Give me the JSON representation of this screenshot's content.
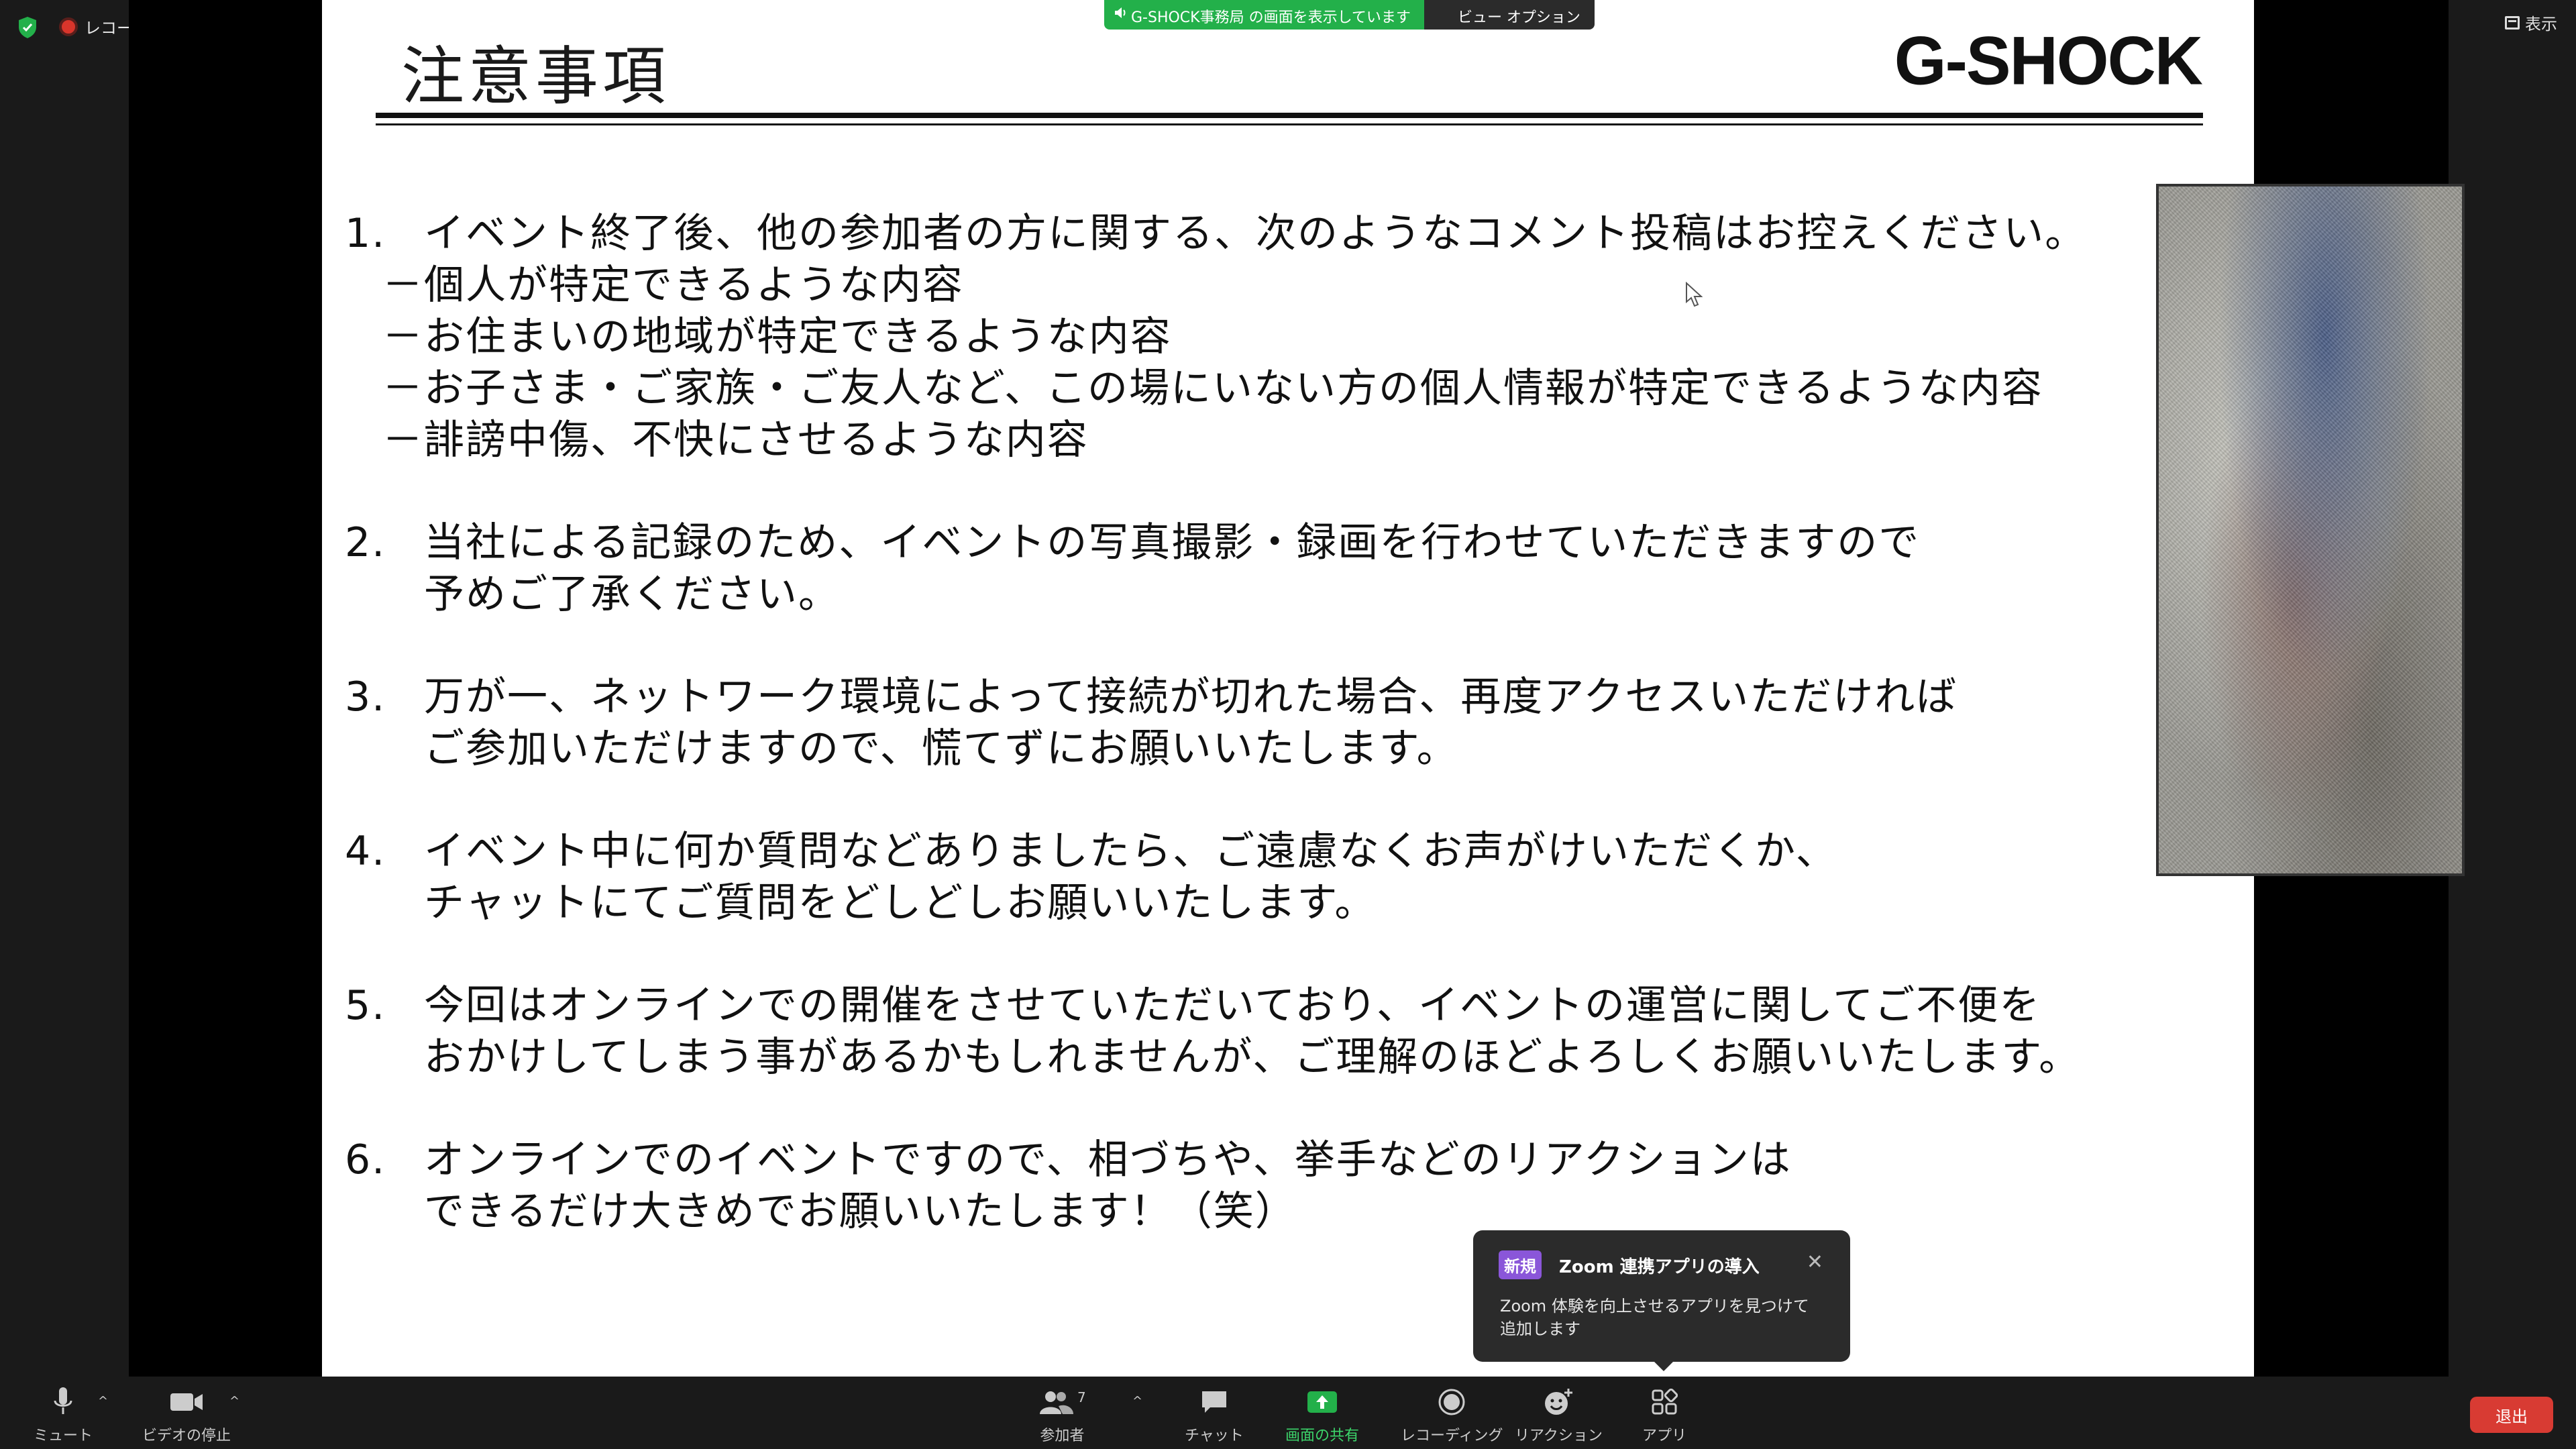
{
  "status_bar": {
    "recording_label": "レコーディング中",
    "view_label": "表示"
  },
  "share_banner": {
    "sharing_text": "G-SHOCK事務局 の画面を表示しています",
    "view_options_label": "ビュー オプション ⌄"
  },
  "slide": {
    "title": "注意事項",
    "logo_text": "G-SHOCK",
    "items": [
      {
        "number": "1.",
        "lines": [
          "イベント終了後、他の参加者の方に関する、次のようなコメント投稿はお控えください。"
        ],
        "subitems": [
          "個人が特定できるような内容",
          "お住まいの地域が特定できるような内容",
          "お子さま・ご家族・ご友人など、この場にいない方の個人情報が特定できるような内容",
          "誹謗中傷、不快にさせるような内容"
        ],
        "dash": "－"
      },
      {
        "number": "2.",
        "lines": [
          "当社による記録のため、イベントの写真撮影・録画を行わせていただきますので",
          "予めご了承ください。"
        ]
      },
      {
        "number": "3.",
        "lines": [
          "万が一、ネットワーク環境によって接続が切れた場合、再度アクセスいただければ",
          "ご参加いただけますので、慌てずにお願いいたします。"
        ]
      },
      {
        "number": "4.",
        "lines": [
          "イベント中に何か質問などありましたら、ご遠慮なくお声がけいただくか、",
          "チャットにてご質問をどしどしお願いいたします。"
        ]
      },
      {
        "number": "5.",
        "lines": [
          "今回はオンラインでの開催をさせていただいており、イベントの運営に関してご不便を",
          "おかけしてしまう事があるかもしれませんが、ご理解のほどよろしくお願いいたします。"
        ]
      },
      {
        "number": "6.",
        "lines": [
          "オンラインでのイベントですので、相づちや、挙手などのリアクションは",
          "できるだけ大きめでお願いいたします！（笑）"
        ]
      }
    ]
  },
  "popup": {
    "badge": "新規",
    "title": "Zoom 連携アプリの導入",
    "body": "Zoom 体験を向上させるアプリを見つけて追加します"
  },
  "toolbar": {
    "mute": "ミュート",
    "video": "ビデオの停止",
    "participants": "参加者",
    "participants_count": "7",
    "chat": "チャット",
    "share": "画面の共有",
    "record": "レコーディング",
    "reactions": "リアクション",
    "apps": "アプリ",
    "leave": "退出"
  },
  "colors": {
    "share_green": "#23b04a",
    "leave_red": "#d83b33",
    "badge_purple": "#8a56d9",
    "toolbar_bg": "#1a1a1a"
  }
}
